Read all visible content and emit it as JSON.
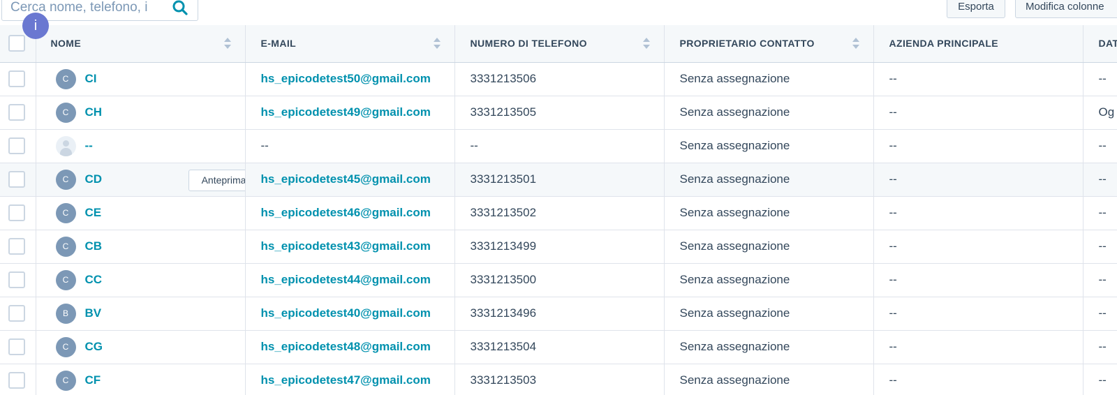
{
  "search": {
    "placeholder": "Cerca nome, telefono, i"
  },
  "toolbar": {
    "export_label": "Esporta",
    "edit_columns_label": "Modifica colonne"
  },
  "info_badge": "i",
  "columns": {
    "name": "NOME",
    "email": "E-MAIL",
    "phone": "NUMERO DI TELEFONO",
    "owner": "PROPRIETARIO CONTATTO",
    "company": "AZIENDA PRINCIPALE",
    "date": "DAT"
  },
  "preview_label": "Anteprima",
  "rows": [
    {
      "initial": "C",
      "name": "CI",
      "email": "hs_epicodetest50@gmail.com",
      "phone": "3331213506",
      "owner": "Senza assegnazione",
      "company": "--",
      "date": "--"
    },
    {
      "initial": "C",
      "name": "CH",
      "email": "hs_epicodetest49@gmail.com",
      "phone": "3331213505",
      "owner": "Senza assegnazione",
      "company": "--",
      "date": "Og"
    },
    {
      "initial": "",
      "name": "--",
      "email": "--",
      "phone": "--",
      "owner": "Senza assegnazione",
      "company": "--",
      "date": "--"
    },
    {
      "initial": "C",
      "name": "CD",
      "email": "hs_epicodetest45@gmail.com",
      "phone": "3331213501",
      "owner": "Senza assegnazione",
      "company": "--",
      "date": "--"
    },
    {
      "initial": "C",
      "name": "CE",
      "email": "hs_epicodetest46@gmail.com",
      "phone": "3331213502",
      "owner": "Senza assegnazione",
      "company": "--",
      "date": "--"
    },
    {
      "initial": "C",
      "name": "CB",
      "email": "hs_epicodetest43@gmail.com",
      "phone": "3331213499",
      "owner": "Senza assegnazione",
      "company": "--",
      "date": "--"
    },
    {
      "initial": "C",
      "name": "CC",
      "email": "hs_epicodetest44@gmail.com",
      "phone": "3331213500",
      "owner": "Senza assegnazione",
      "company": "--",
      "date": "--"
    },
    {
      "initial": "B",
      "name": "BV",
      "email": "hs_epicodetest40@gmail.com",
      "phone": "3331213496",
      "owner": "Senza assegnazione",
      "company": "--",
      "date": "--"
    },
    {
      "initial": "C",
      "name": "CG",
      "email": "hs_epicodetest48@gmail.com",
      "phone": "3331213504",
      "owner": "Senza assegnazione",
      "company": "--",
      "date": "--"
    },
    {
      "initial": "C",
      "name": "CF",
      "email": "hs_epicodetest47@gmail.com",
      "phone": "3331213503",
      "owner": "Senza assegnazione",
      "company": "--",
      "date": "--"
    }
  ],
  "colors": {
    "link": "#0091ae",
    "avatar": "#7c98b6",
    "info_badge": "#6a78d1",
    "header_bg": "#f5f8fa"
  },
  "icons": {
    "search": "search-icon",
    "sort": "sort-icon",
    "empty_avatar": "person-placeholder-icon"
  }
}
